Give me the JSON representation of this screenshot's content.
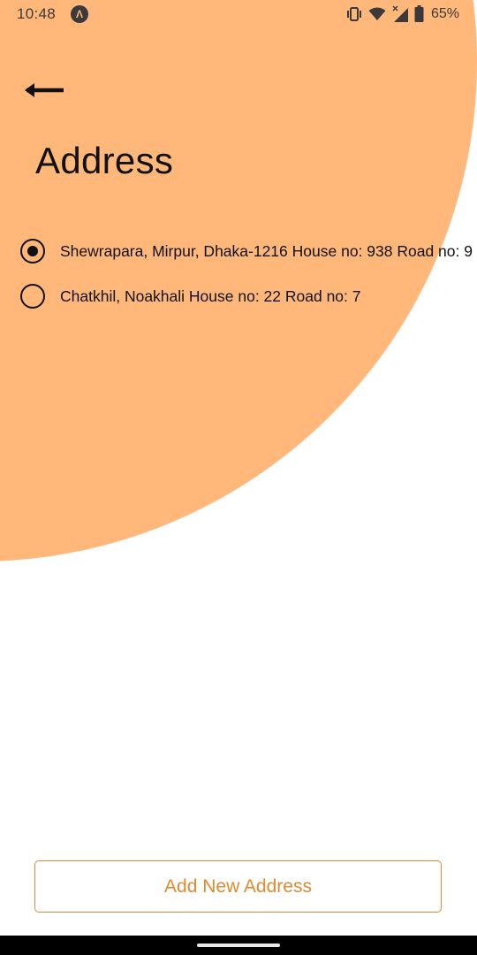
{
  "status_bar": {
    "time": "10:48",
    "app_icon_glyph": "Λ",
    "battery_percent": "65%",
    "icons": [
      "app-notification-icon",
      "vibrate-icon",
      "wifi-icon",
      "signal-icon",
      "battery-icon"
    ]
  },
  "header": {
    "back_icon": "arrow-left-icon",
    "title": "Address"
  },
  "addresses": [
    {
      "label": "Shewrapara, Mirpur, Dhaka-1216 House no: 938 Road no: 9",
      "selected": true
    },
    {
      "label": "Chatkhil, Noakhali House no: 22 Road no: 7",
      "selected": false
    }
  ],
  "footer": {
    "add_button_label": "Add New Address"
  },
  "colors": {
    "background_accent": "#FFB77A",
    "button_accent": "#E08A2E",
    "text_primary": "#111111"
  }
}
